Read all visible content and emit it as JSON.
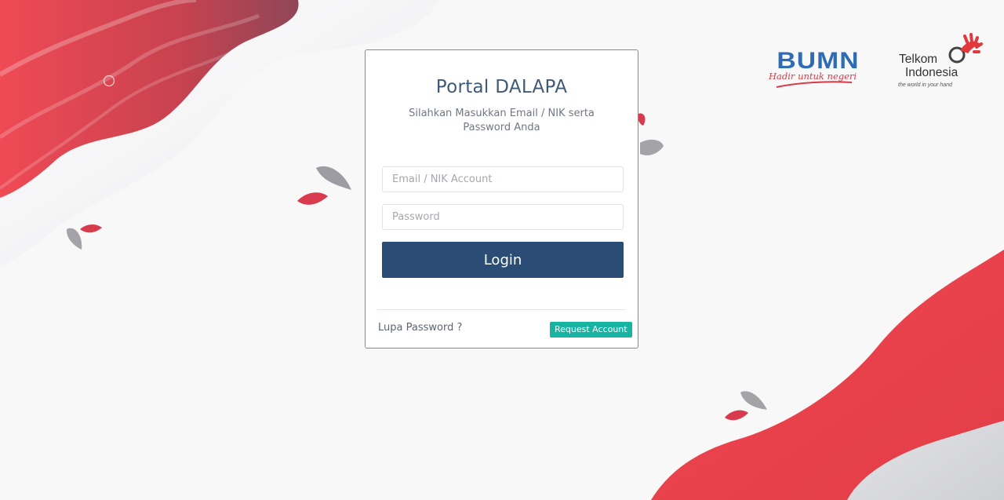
{
  "login": {
    "title": "Portal DALAPA",
    "subtitle": "Silahkan Masukkan Email / NIK serta Password Anda",
    "email_placeholder": "Email / NIK Account",
    "email_value": "",
    "password_placeholder": "Password",
    "password_value": "",
    "login_label": "Login",
    "forgot_label": "Lupa Password ?",
    "request_label": "Request Account"
  },
  "logos": {
    "bumn": {
      "name": "BUMN",
      "tagline": "Hadir untuk negeri"
    },
    "telkom": {
      "name_line1": "Telkom",
      "name_line2": "Indonesia",
      "tagline": "the world in your hand"
    }
  },
  "colors": {
    "primary": "#2b4d75",
    "accent_red": "#e8414e",
    "teal": "#17b3a3",
    "bumn_blue": "#2f6cb3"
  }
}
